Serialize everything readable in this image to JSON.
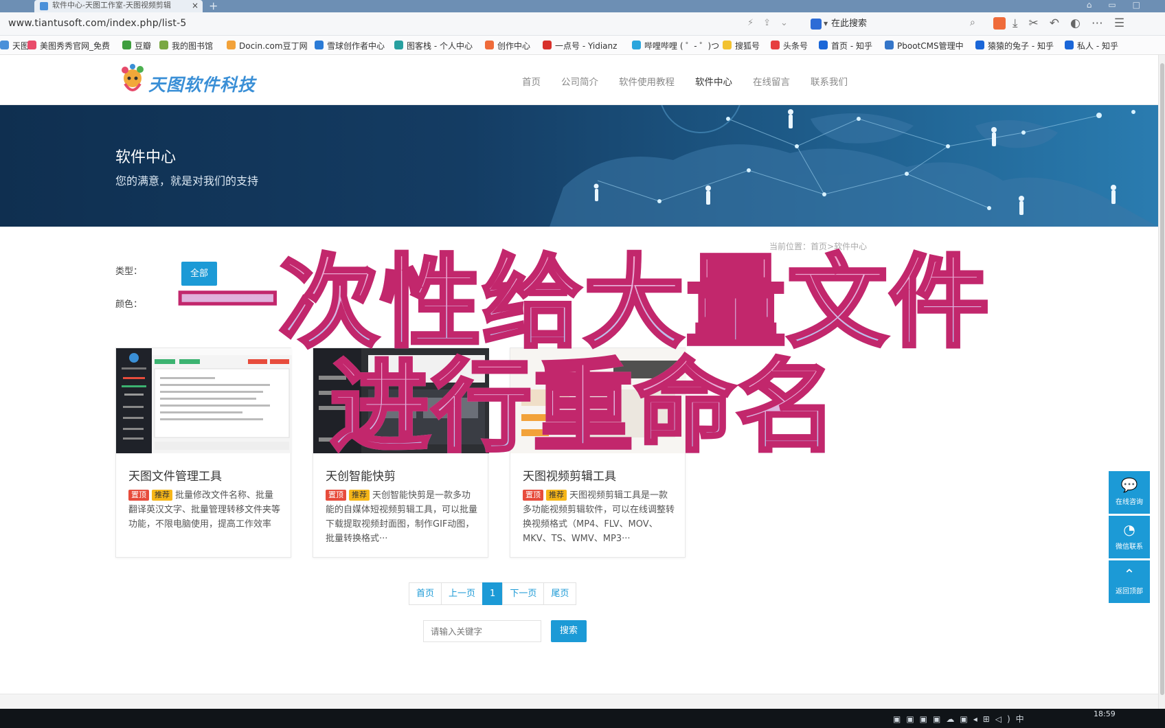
{
  "browser": {
    "tab_title": "软件中心-天图工作室-天图视频剪辑",
    "tab_close": "×",
    "new_tab": "+",
    "url": "www.tiantusoft.com/index.php/list-5",
    "search_placeholder": "在此搜索",
    "bookmarks": [
      {
        "label": "天图",
        "color": "#4a90d9"
      },
      {
        "label": "美图秀秀官网_免费",
        "color": "#e94b6a"
      },
      {
        "label": "豆瓣",
        "color": "#3f9e3f"
      },
      {
        "label": "我的图书馆",
        "color": "#7aa843"
      },
      {
        "label": "Docin.com豆丁网",
        "color": "#f2a23a"
      },
      {
        "label": "雪球创作者中心",
        "color": "#2b7bd6"
      },
      {
        "label": "图客栈 - 个人中心",
        "color": "#28a0a0"
      },
      {
        "label": "创作中心",
        "color": "#ef6b3a"
      },
      {
        "label": "一点号 - Yidianz",
        "color": "#d8312b"
      },
      {
        "label": "哔哩哔哩 ( ゜- ゜)つ",
        "color": "#2aa5dd"
      },
      {
        "label": "搜狐号",
        "color": "#f2c230"
      },
      {
        "label": "头条号",
        "color": "#e63f3f"
      },
      {
        "label": "首页 - 知乎",
        "color": "#1a66d8"
      },
      {
        "label": "PbootCMS管理中",
        "color": "#3576c9"
      },
      {
        "label": "猿猿的兔子 - 知乎",
        "color": "#1a66d8"
      },
      {
        "label": "私人 - 知乎",
        "color": "#1a66d8"
      }
    ]
  },
  "site": {
    "logo_text": "天图软件科技",
    "nav": [
      {
        "label": "首页",
        "active": false
      },
      {
        "label": "公司简介",
        "active": false
      },
      {
        "label": "软件使用教程",
        "active": false
      },
      {
        "label": "软件中心",
        "active": true
      },
      {
        "label": "在线留言",
        "active": false
      },
      {
        "label": "联系我们",
        "active": false
      }
    ]
  },
  "banner": {
    "title": "软件中心",
    "subtitle": "您的满意，就是对我们的支持"
  },
  "breadcrumb": {
    "prefix": "当前位置：",
    "home": "首页",
    "sep": ">",
    "current": "软件中心"
  },
  "filters": {
    "type_label": "类型：",
    "type_all": "全部",
    "color_label": "颜色："
  },
  "tags": {
    "top": "置顶",
    "recommend": "推荐"
  },
  "products": [
    {
      "title": "天图文件管理工具",
      "desc": "批量修改文件名称、批量翻译英汉文字、批量管理转移文件夹等功能，不限电脑使用，提高工作效率"
    },
    {
      "title": "天创智能快剪",
      "desc": "天创智能快剪是一款多功能的自媒体短视频剪辑工具，可以批量下载提取视频封面图，制作GIF动图，批量转换格式···"
    },
    {
      "title": "天图视频剪辑工具",
      "desc": "天图视频剪辑工具是一款多功能视频剪辑软件，可以在线调整转换视频格式（MP4、FLV、MOV、MKV、TS、WMV、MP3···"
    }
  ],
  "pagination": {
    "first": "首页",
    "prev": "上一页",
    "current": "1",
    "next": "下一页",
    "last": "尾页"
  },
  "search": {
    "placeholder": "请输入关键字",
    "button": "搜索"
  },
  "float_panel": {
    "consult": "在线咨询",
    "wechat": "微信联系",
    "top": "返回顶部"
  },
  "overlay": {
    "line1": "一次性给大量文件",
    "line2": "进行重命名"
  },
  "colors": {
    "accent": "#1c9ad6",
    "tag_top": "#e74c3c",
    "tag_recommend": "#f6b618",
    "overlay_stroke": "#c2276c"
  },
  "taskbar": {
    "time": "18:59"
  }
}
